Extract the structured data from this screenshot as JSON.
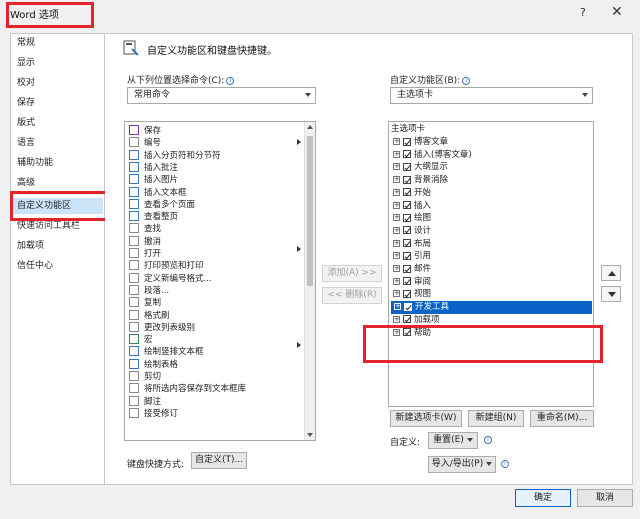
{
  "window": {
    "title": "Word 选项",
    "help": "?",
    "close": "✕"
  },
  "nav": {
    "items": [
      "常规",
      "显示",
      "校对",
      "保存",
      "版式",
      "语言",
      "辅助功能",
      "高级",
      "自定义功能区",
      "快速访问工具栏",
      "加载项",
      "信任中心"
    ],
    "selected_index": 8
  },
  "main": {
    "heading": "自定义功能区和键盘快捷键。",
    "choose_label": "从下列位置选择命令(C):",
    "choose_value": "常用命令",
    "customize_label": "自定义功能区(B):",
    "customize_value": "主选项卡",
    "commands": [
      "保存",
      "编号",
      "插入分页符和分节符",
      "插入批注",
      "插入图片",
      "插入文本框",
      "查看多个页面",
      "查看整页",
      "查找",
      "撤消",
      "打开",
      "打印预览和打印",
      "定义新编号格式...",
      "段落...",
      "复制",
      "格式刷",
      "更改列表级别",
      "宏",
      "绘制竖排文本框",
      "绘制表格",
      "剪切",
      "将所选内容保存到文本框库",
      "脚注",
      "接受修订"
    ],
    "tabs_header": "主选项卡",
    "tabs": [
      "博客文章",
      "插入(博客文章)",
      "大纲显示",
      "背景消除",
      "开始",
      "插入",
      "绘图",
      "设计",
      "布局",
      "引用",
      "邮件",
      "审阅",
      "视图",
      "开发工具",
      "加载项",
      "帮助"
    ],
    "selected_tab_index": 13,
    "add_button": "添加(A) >>",
    "remove_button": "<< 删除(R)",
    "new_tab_button": "新建选项卡(W)",
    "new_group_button": "新建组(N)",
    "rename_button": "重命名(M)...",
    "custom_label": "自定义:",
    "reset_button": "重置(E)",
    "import_export_button": "导入/导出(P)",
    "shortcut_label": "键盘快捷方式:",
    "shortcut_button": "自定义(T)..."
  },
  "footer": {
    "ok": "确定",
    "cancel": "取消"
  },
  "colors": {
    "selection": "#0a64c8",
    "nav_selection": "#cce4f7",
    "highlight_box": "#e3242b"
  }
}
